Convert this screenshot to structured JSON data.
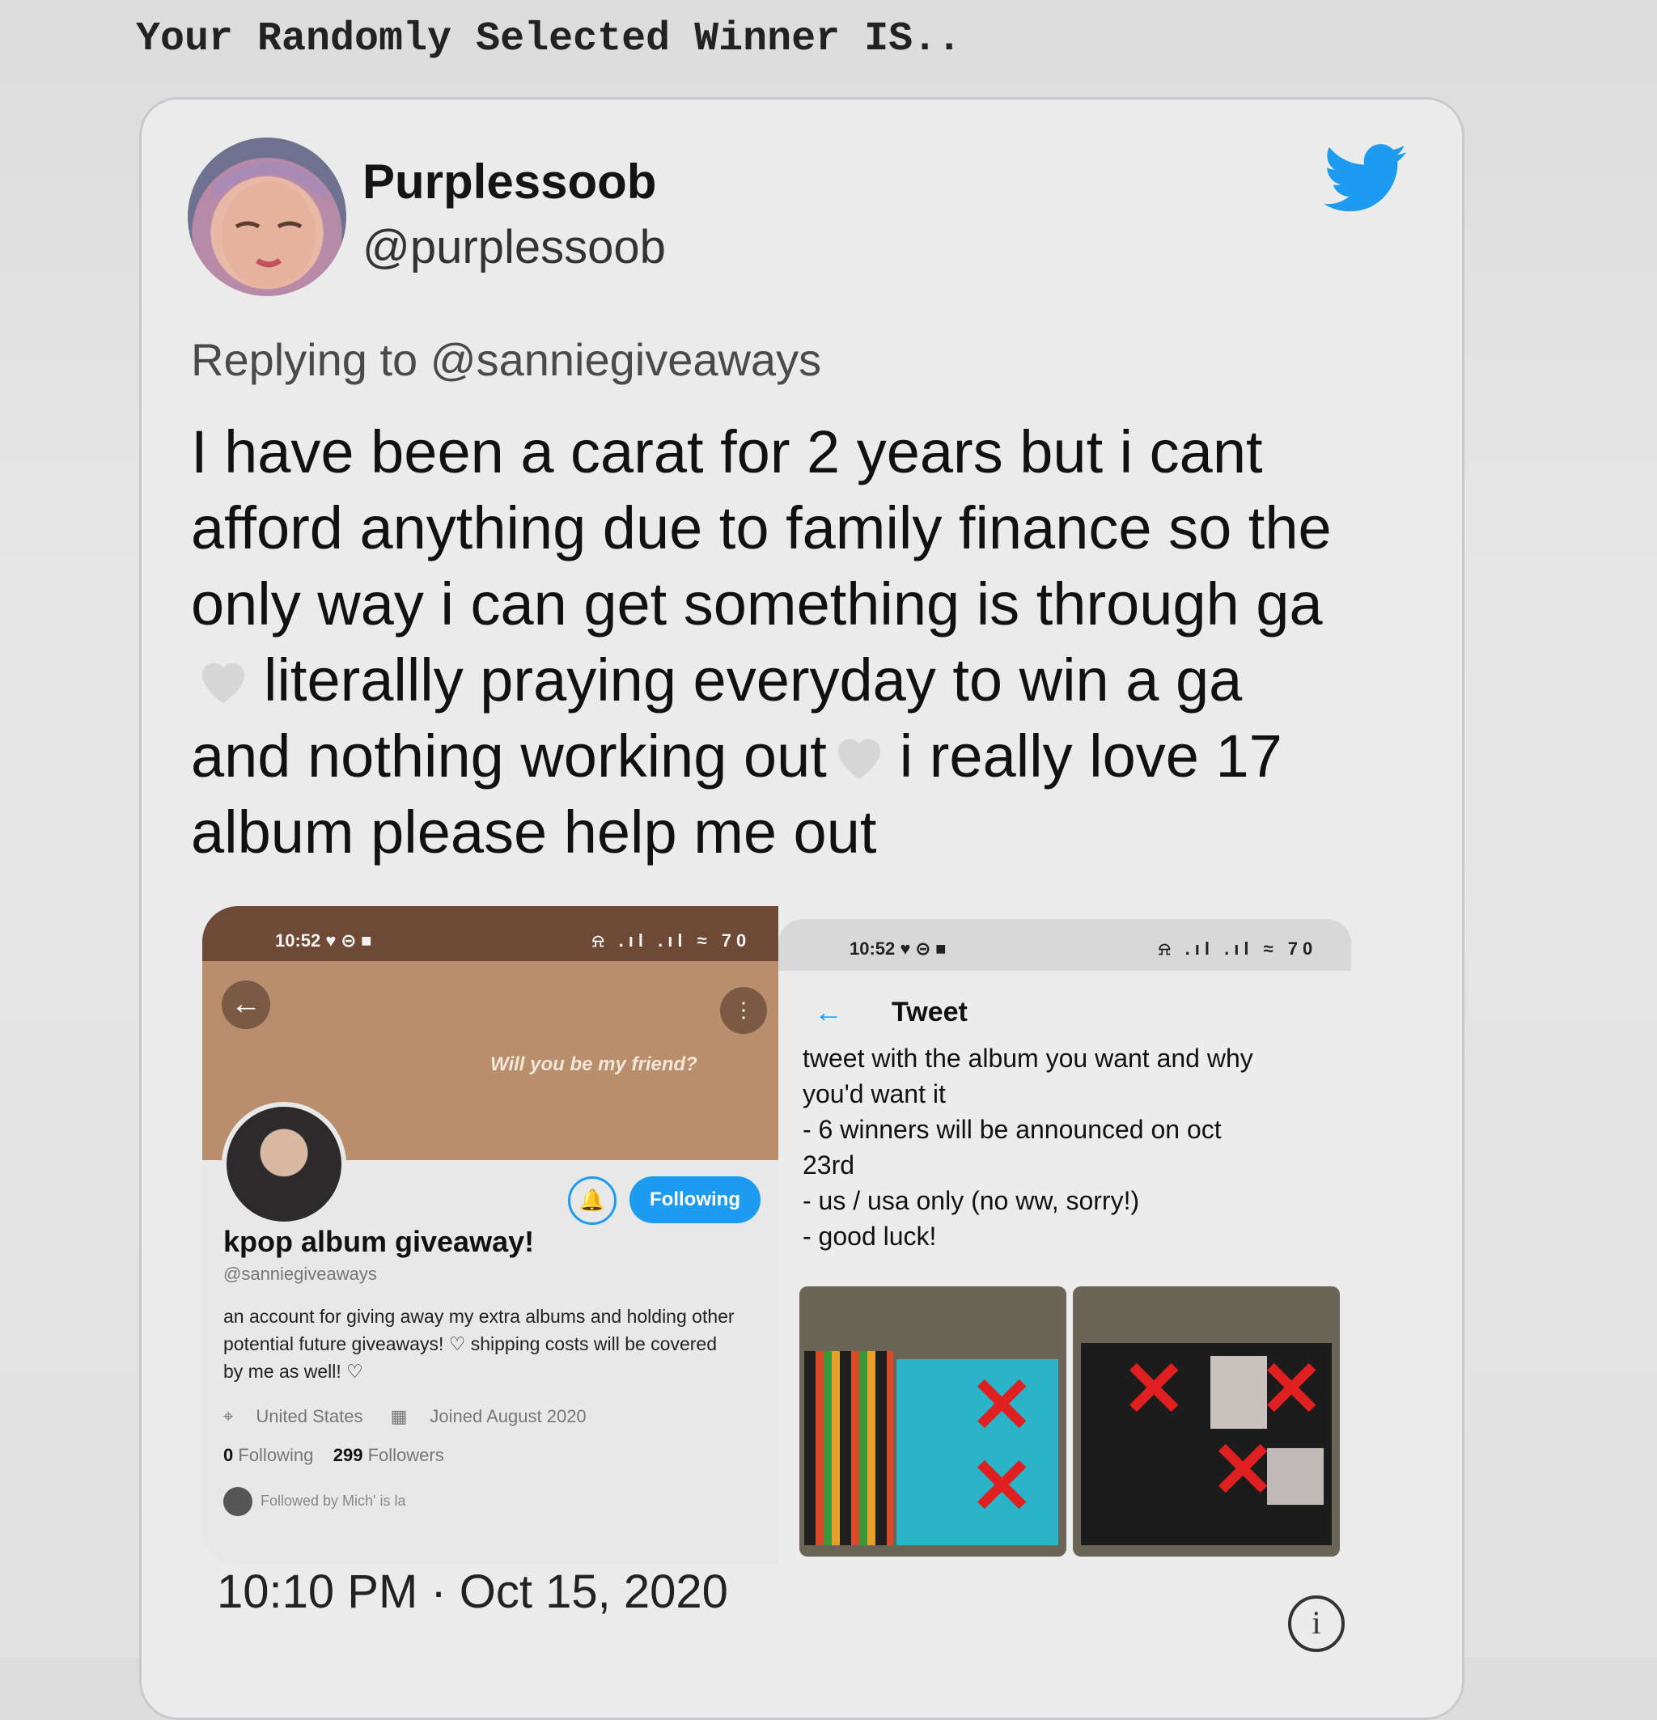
{
  "header": {
    "title": "Your Randomly Selected Winner IS.."
  },
  "tweet": {
    "display_name": "Purplessoob",
    "handle": "@purplessoob",
    "replying_prefix": "Replying to",
    "replying_to": "@sanniegiveaways",
    "text_lines": [
      "I have been a carat for 2 years but i cant",
      "afford anything due to family finance so the",
      "only way i can get something is through ga",
      "literallly praying everyday to win a ga",
      "and nothing working out",
      "i really love 17",
      "album please help me out"
    ],
    "timestamp": "10:10 PM · Oct 15, 2020",
    "heart_color": "#d8d8d8",
    "brand_color": "#1d9bf0"
  },
  "media": {
    "profile_screenshot": {
      "status_time": "10:52",
      "status_icons": "♥ ⊝ ■",
      "status_right": "⍾ .ıl .ıl ≈ 70",
      "banner_text": "Will you be my friend?",
      "following_label": "Following",
      "name": "kpop album giveaway!",
      "handle": "@sanniegiveaways",
      "bio": "an account for giving away my extra albums and holding other potential future giveaways! ♡ shipping costs will be covered by me as well! ♡",
      "location": "United States",
      "joined": "Joined August 2020",
      "following_count": "0",
      "following_label_text": "Following",
      "followers_count": "299",
      "followers_label_text": "Followers",
      "followed_by": "Followed by Mich' is la"
    },
    "tweet_screenshot": {
      "status_time": "10:52",
      "status_icons": "♥ ⊝ ■",
      "status_right": "⍾ .ıl .ıl ≈ 70",
      "title": "Tweet",
      "lines": [
        "tweet with the album you want and why",
        "you'd want it",
        "- 6 winners will be announced on oct",
        "23rd",
        "- us / usa only (no ww, sorry!)",
        "- good luck!"
      ]
    }
  }
}
